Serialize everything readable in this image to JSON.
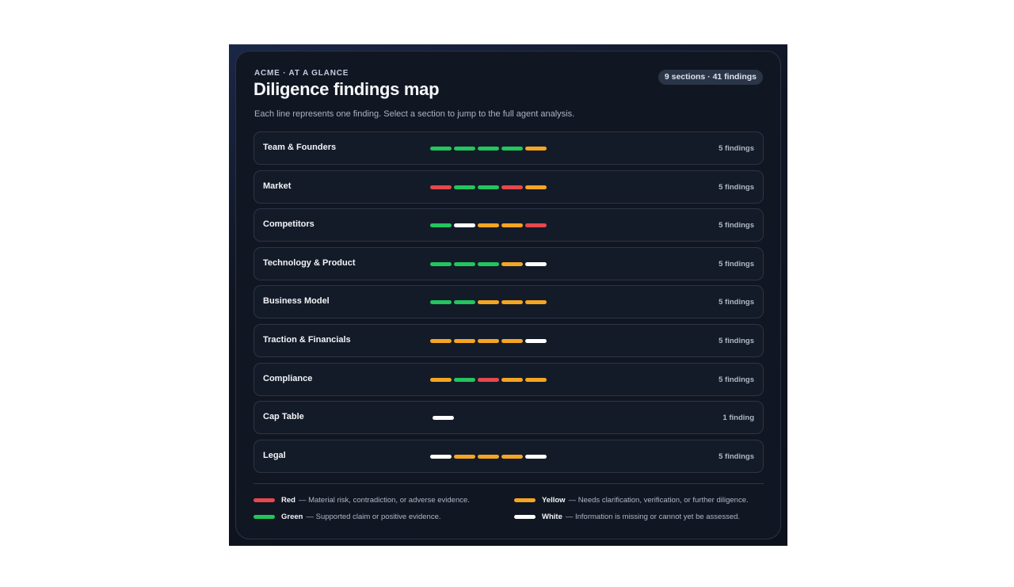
{
  "header": {
    "eyebrow": "ACME · AT A GLANCE",
    "title": "Diligence findings map",
    "subtitle": "Each line represents one finding. Select a section to jump to the full agent analysis.",
    "badge": "9 sections · 41 findings"
  },
  "colors": {
    "red": "#e5484d",
    "green": "#22c55e",
    "yellow": "#f5a524",
    "white": "#ffffff"
  },
  "sections": [
    {
      "label": "Team & Founders",
      "count": "5 findings",
      "findings": [
        "green",
        "green",
        "green",
        "green",
        "yellow"
      ]
    },
    {
      "label": "Market",
      "count": "5 findings",
      "findings": [
        "red",
        "green",
        "green",
        "red",
        "yellow"
      ]
    },
    {
      "label": "Competitors",
      "count": "5 findings",
      "findings": [
        "green",
        "white",
        "yellow",
        "yellow",
        "red"
      ]
    },
    {
      "label": "Technology & Product",
      "count": "5 findings",
      "findings": [
        "green",
        "green",
        "green",
        "yellow",
        "white"
      ]
    },
    {
      "label": "Business Model",
      "count": "5 findings",
      "findings": [
        "green",
        "green",
        "yellow",
        "yellow",
        "yellow"
      ]
    },
    {
      "label": "Traction & Financials",
      "count": "5 findings",
      "findings": [
        "yellow",
        "yellow",
        "yellow",
        "yellow",
        "white"
      ]
    },
    {
      "label": "Compliance",
      "count": "5 findings",
      "findings": [
        "yellow",
        "green",
        "red",
        "yellow",
        "yellow"
      ]
    },
    {
      "label": "Cap Table",
      "count": "1 finding",
      "findings": [
        "white"
      ]
    },
    {
      "label": "Legal",
      "count": "5 findings",
      "findings": [
        "white",
        "yellow",
        "yellow",
        "yellow",
        "white"
      ]
    }
  ],
  "legend": {
    "red": {
      "name": "Red",
      "desc": "— Material risk, contradiction, or adverse evidence."
    },
    "yellow": {
      "name": "Yellow",
      "desc": "— Needs clarification, verification, or further diligence."
    },
    "green": {
      "name": "Green",
      "desc": "— Supported claim or positive evidence."
    },
    "white": {
      "name": "White",
      "desc": "— Information is missing or cannot yet be assessed."
    }
  }
}
